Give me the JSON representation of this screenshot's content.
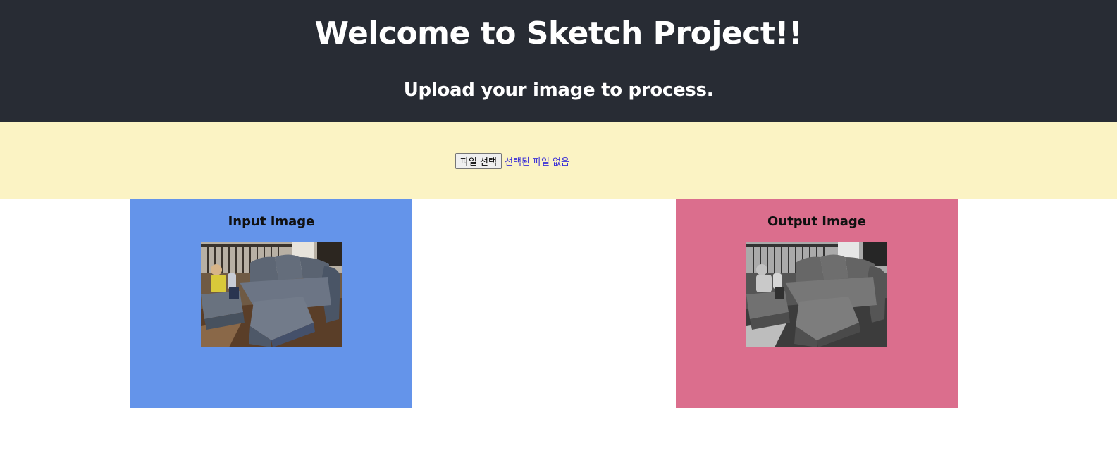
{
  "header": {
    "title": "Welcome to Sketch Project!!",
    "subtitle": "Upload your image to process."
  },
  "upload": {
    "button_label": "파일 선택",
    "status_text": "선택된 파일 없음"
  },
  "panels": {
    "input": {
      "label": "Input Image",
      "background": "#6494ea",
      "image_description_icon": "photo-color-icon"
    },
    "output": {
      "label": "Output Image",
      "background": "#db6e8d",
      "image_description_icon": "photo-grayscale-icon"
    }
  },
  "colors": {
    "header_bg": "#282c34",
    "upload_band_bg": "#fbf3c4",
    "file_status_text": "#3a2fd6"
  }
}
